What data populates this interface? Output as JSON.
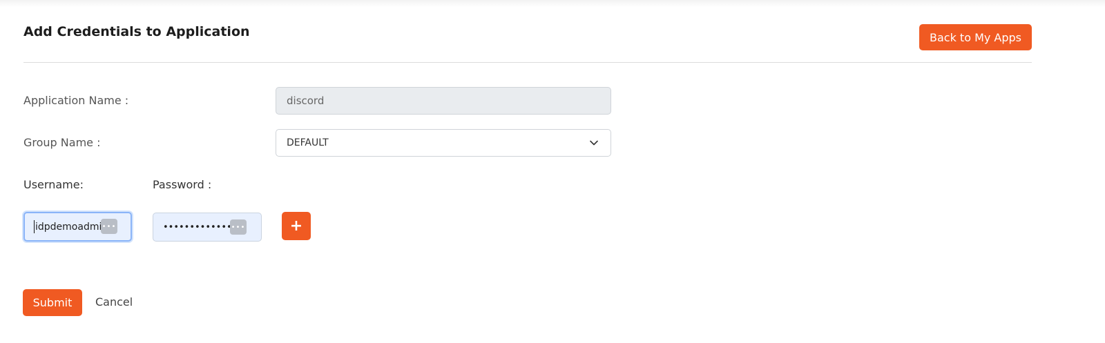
{
  "header": {
    "title": "Add Credentials to Application",
    "back_button_label": "Back to My Apps"
  },
  "form": {
    "application_name": {
      "label": "Application Name :",
      "value": "discord"
    },
    "group_name": {
      "label": "Group Name :",
      "selected": "DEFAULT"
    },
    "username": {
      "label": "Username:",
      "value": "idpdemoadmin"
    },
    "password": {
      "label": "Password :",
      "masked_value": "•••••••••••••"
    },
    "password_manager_icon": "password-manager-icon",
    "add_button_icon": "plus-icon",
    "add_button_glyph": "+",
    "submit_label": "Submit",
    "cancel_label": "Cancel"
  },
  "colors": {
    "accent": "#f05a22",
    "input_disabled_bg": "#e9ecef",
    "autofill_bg": "#e8f0fe"
  }
}
